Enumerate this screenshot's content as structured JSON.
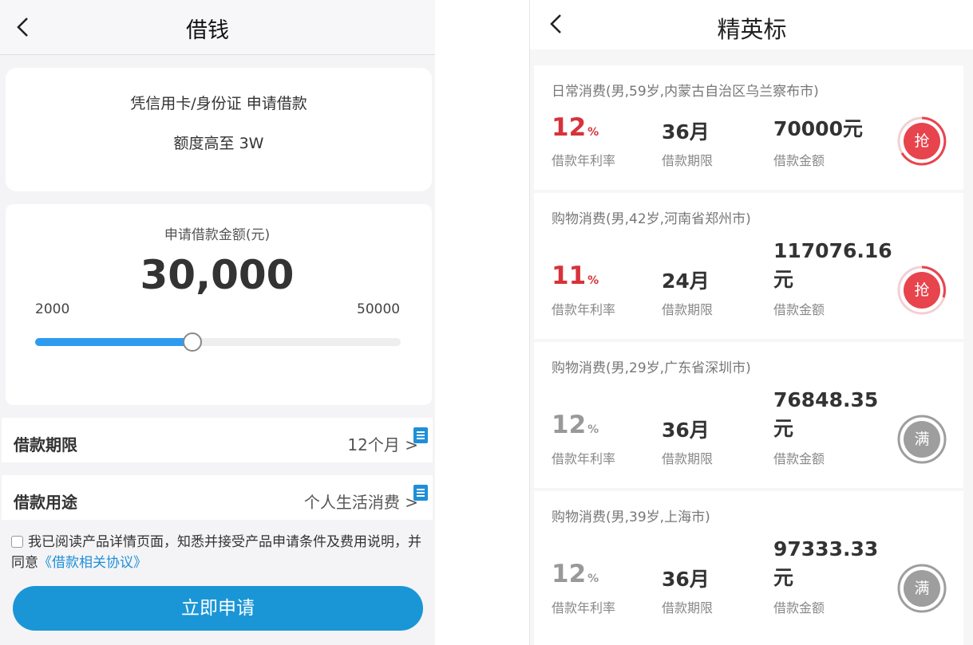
{
  "colors": {
    "accent": "#1a96d6",
    "slider": "#2d9cf0",
    "rate_red": "#d7323a",
    "rate_gray": "#999999",
    "grab": "#e8444d",
    "full": "#9e9e9e"
  },
  "left": {
    "title": "借钱",
    "intro": {
      "line1": "凭信用卡/身份证 申请借款",
      "line2": "额度高至 3W"
    },
    "amount": {
      "label": "申请借款金额(元)",
      "value": "30,000",
      "min": "2000",
      "max": "50000",
      "fraction": 0.43
    },
    "term": {
      "label": "借款期限",
      "value": "12个月 >"
    },
    "purpose": {
      "label": "借款用途",
      "value": "个人生活消费 >"
    },
    "agreement": {
      "text": "我已阅读产品详情页面，知悉并接受产品申请条件及费用说明，并同意",
      "link": "《借款相关协议》"
    },
    "apply_label": "立即申请"
  },
  "right": {
    "title": "精英标",
    "captions": {
      "rate": "借款年利率",
      "term": "借款期限",
      "amount": "借款金额"
    },
    "items": [
      {
        "category": "日常消费(男,59岁,内蒙古自治区乌兰察布市)",
        "rate": "12",
        "rate_unit": "%",
        "term": "36月",
        "amount": "70000元",
        "button": "抢",
        "status": "open"
      },
      {
        "category": "购物消费(男,42岁,河南省郑州市)",
        "rate": "11",
        "rate_unit": "%",
        "term": "24月",
        "amount": "117076.16元",
        "button": "抢",
        "status": "open"
      },
      {
        "category": "购物消费(男,29岁,广东省深圳市)",
        "rate": "12",
        "rate_unit": "%",
        "term": "36月",
        "amount": "76848.35元",
        "button": "满",
        "status": "full"
      },
      {
        "category": "购物消费(男,39岁,上海市)",
        "rate": "12",
        "rate_unit": "%",
        "term": "36月",
        "amount": "97333.33元",
        "button": "满",
        "status": "full"
      }
    ]
  }
}
